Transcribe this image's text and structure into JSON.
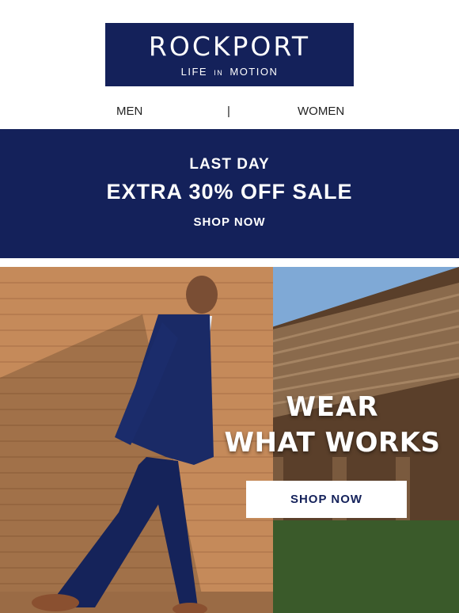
{
  "header": {
    "logo_word": "ROCKPORT",
    "tagline_left": "LIFE",
    "tagline_mid": "IN",
    "tagline_right": "MOTION"
  },
  "nav": {
    "men": "MEN",
    "separator": "|",
    "women": "WOMEN"
  },
  "promo": {
    "line1": "LAST DAY",
    "line2": "EXTRA 30% OFF SALE",
    "cta": "SHOP NOW"
  },
  "hero": {
    "title_line1": "WEAR",
    "title_line2": "WHAT WORKS",
    "cta": "SHOP NOW",
    "image": "man-in-navy-suit-photo"
  },
  "colors": {
    "navy": "#14215a",
    "white": "#ffffff",
    "brick": "#c58a5a"
  }
}
